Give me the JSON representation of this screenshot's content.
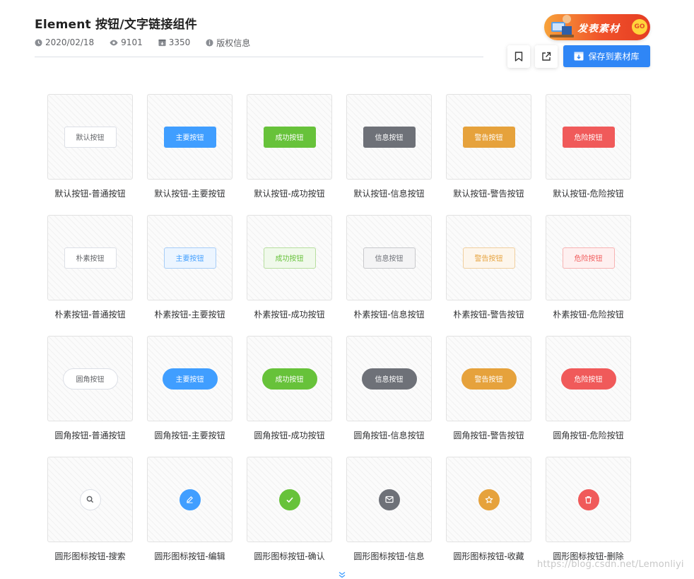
{
  "header": {
    "title": "Element 按钮/文字链接组件",
    "date": "2020/02/18",
    "views": "9101",
    "downloads": "3350",
    "copyright": "版权信息"
  },
  "promo": {
    "label": "发表素材",
    "go": "GO"
  },
  "actions": {
    "save_label": "保存到素材库"
  },
  "colors": {
    "primary": "#409eff",
    "success": "#67c23a",
    "info": "#6e7178",
    "warning": "#e6a23c",
    "danger": "#f05a5a",
    "save_button": "#2f86f6"
  },
  "rows": [
    {
      "style": "normal",
      "cards": [
        {
          "variant": "default",
          "text": "默认按钮",
          "caption": "默认按钮-普通按钮"
        },
        {
          "variant": "primary",
          "text": "主要按钮",
          "caption": "默认按钮-主要按钮"
        },
        {
          "variant": "success",
          "text": "成功按钮",
          "caption": "默认按钮-成功按钮"
        },
        {
          "variant": "info",
          "text": "信息按钮",
          "caption": "默认按钮-信息按钮"
        },
        {
          "variant": "warning",
          "text": "警告按钮",
          "caption": "默认按钮-警告按钮"
        },
        {
          "variant": "danger",
          "text": "危险按钮",
          "caption": "默认按钮-危险按钮"
        }
      ]
    },
    {
      "style": "plain",
      "cards": [
        {
          "variant": "default",
          "text": "朴素按钮",
          "caption": "朴素按钮-普通按钮"
        },
        {
          "variant": "primary",
          "text": "主要按钮",
          "caption": "朴素按钮-主要按钮"
        },
        {
          "variant": "success",
          "text": "成功按钮",
          "caption": "朴素按钮-成功按钮"
        },
        {
          "variant": "info",
          "text": "信息按钮",
          "caption": "朴素按钮-信息按钮"
        },
        {
          "variant": "warning",
          "text": "警告按钮",
          "caption": "朴素按钮-警告按钮"
        },
        {
          "variant": "danger",
          "text": "危险按钮",
          "caption": "朴素按钮-危险按钮"
        }
      ]
    },
    {
      "style": "round",
      "cards": [
        {
          "variant": "default",
          "text": "圆角按钮",
          "caption": "圆角按钮-普通按钮"
        },
        {
          "variant": "primary",
          "text": "主要按钮",
          "caption": "圆角按钮-主要按钮"
        },
        {
          "variant": "success",
          "text": "成功按钮",
          "caption": "圆角按钮-成功按钮"
        },
        {
          "variant": "info",
          "text": "信息按钮",
          "caption": "圆角按钮-信息按钮"
        },
        {
          "variant": "warning",
          "text": "警告按钮",
          "caption": "圆角按钮-警告按钮"
        },
        {
          "variant": "danger",
          "text": "危险按钮",
          "caption": "圆角按钮-危险按钮"
        }
      ]
    },
    {
      "style": "circle",
      "cards": [
        {
          "variant": "default",
          "icon": "search-icon",
          "caption": "圆形图标按钮-搜索"
        },
        {
          "variant": "primary",
          "icon": "edit-icon",
          "caption": "圆形图标按钮-编辑"
        },
        {
          "variant": "success",
          "icon": "check-icon",
          "caption": "圆形图标按钮-确认"
        },
        {
          "variant": "info",
          "icon": "message-icon",
          "caption": "圆形图标按钮-信息"
        },
        {
          "variant": "warning",
          "icon": "star-icon",
          "caption": "圆形图标按钮-收藏"
        },
        {
          "variant": "danger",
          "icon": "delete-icon",
          "caption": "圆形图标按钮-删除"
        }
      ]
    }
  ],
  "watermark": "https://blog.csdn.net/Lemonliyi"
}
